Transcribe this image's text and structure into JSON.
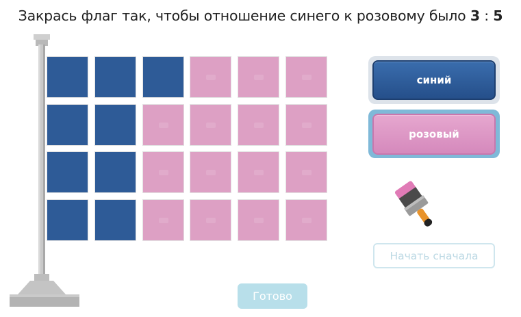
{
  "task": {
    "text": "Закрась флаг так, чтобы отношение синего к розовому было ",
    "ratio_left": "3",
    "ratio_sep": " : ",
    "ratio_right": "5"
  },
  "flag": {
    "rows": 4,
    "cols": 6,
    "colors": {
      "blue": "#2e5b97",
      "pink": "#dda0c4"
    },
    "cells": [
      [
        "blue",
        "blue",
        "blue",
        "pink",
        "pink",
        "pink"
      ],
      [
        "blue",
        "blue",
        "pink",
        "pink",
        "pink",
        "pink"
      ],
      [
        "blue",
        "blue",
        "pink",
        "pink",
        "pink",
        "pink"
      ],
      [
        "blue",
        "blue",
        "pink",
        "pink",
        "pink",
        "pink"
      ]
    ]
  },
  "palette": {
    "blue_label": "синий",
    "pink_label": "розовый",
    "selected": "pink"
  },
  "buttons": {
    "restart_label": "Начать сначала",
    "done_label": "Готово"
  }
}
